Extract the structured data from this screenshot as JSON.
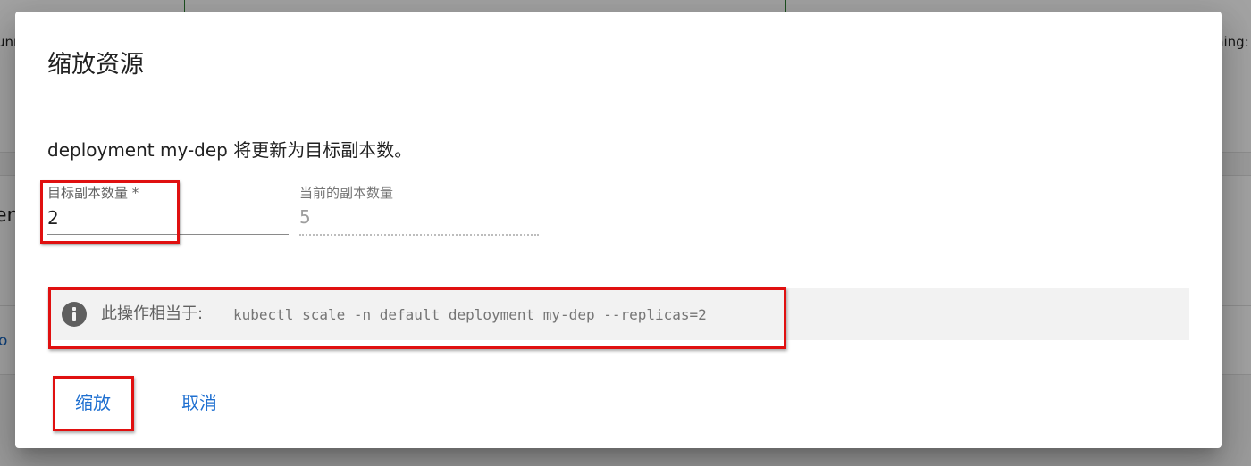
{
  "background": {
    "left_fragment_1": "unn",
    "right_fragment_1": "ning:",
    "left_fragment_2": "en",
    "left_fragment_3": "o"
  },
  "dialog": {
    "title": "缩放资源",
    "description": "deployment my-dep 将更新为目标副本数。",
    "target_replicas": {
      "label": "目标副本数量 *",
      "value": "2"
    },
    "current_replicas": {
      "label": "当前的副本数量",
      "value": "5"
    },
    "info": {
      "icon": "info-icon",
      "prefix": "此操作相当于:",
      "command": "kubectl scale -n default deployment my-dep --replicas=2"
    },
    "actions": {
      "scale_label": "缩放",
      "cancel_label": "取消"
    }
  },
  "colors": {
    "accent": "#1e6fd0",
    "annotation": "#e01010",
    "info_background": "#f2f2f2"
  }
}
